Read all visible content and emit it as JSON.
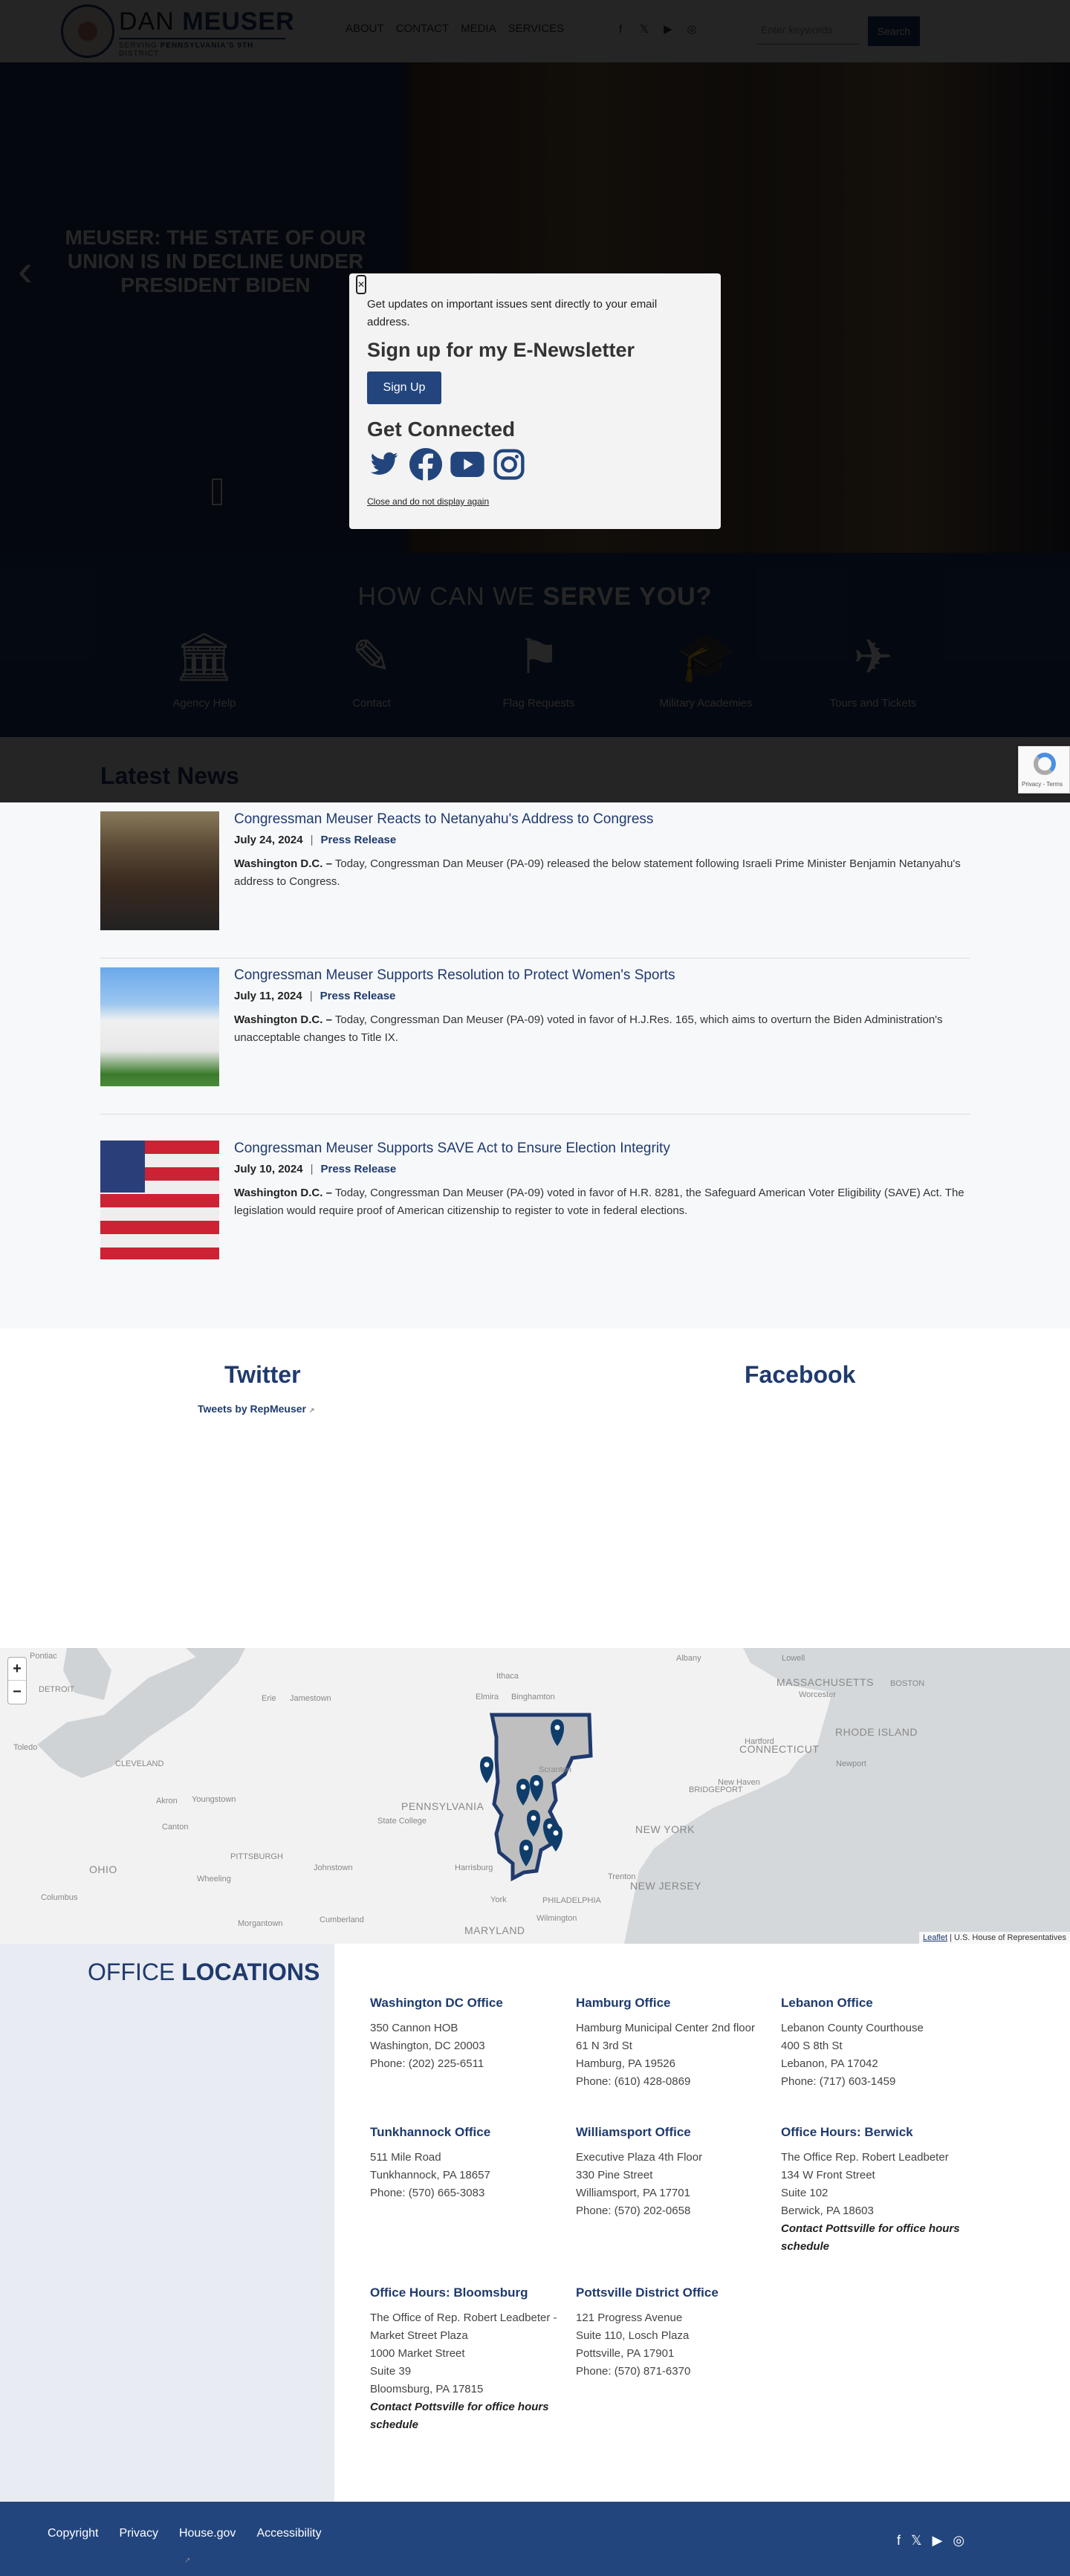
{
  "header": {
    "brand_first": "DAN",
    "brand_last": "MEUSER",
    "brand_sub_prefix": "SERVING",
    "brand_sub_bold": "PENNSYLVANIA'S 9TH",
    "brand_sub_suffix": "DISTRICT",
    "nav": [
      "ABOUT",
      "CONTACT",
      "MEDIA",
      "SERVICES"
    ],
    "social_icons": [
      "facebook-icon",
      "x-icon",
      "youtube-icon",
      "instagram-icon"
    ],
    "search_placeholder": "Enter keywords",
    "search_button": "Search"
  },
  "hero": {
    "title": "MEUSER: THE STATE OF OUR UNION IS IN DECLINE UNDER PRESIDENT BIDEN",
    "prev_icon": "chevron-left-icon"
  },
  "serve": {
    "title_light": "HOW CAN WE",
    "title_bold": "SERVE YOU?",
    "items": [
      {
        "label": "Agency Help",
        "icon": "building-columns-icon"
      },
      {
        "label": "Contact",
        "icon": "pencil-icon"
      },
      {
        "label": "Flag Requests",
        "icon": "flag-icon"
      },
      {
        "label": "Military Academies",
        "icon": "graduation-cap-icon"
      },
      {
        "label": "Tours and Tickets",
        "icon": "airplane-icon"
      }
    ]
  },
  "news": {
    "title": "Latest News",
    "articles": [
      {
        "title": "Congressman Meuser Reacts to Netanyahu's Address to Congress",
        "date": "July 24, 2024",
        "category": "Press Release",
        "dateline": "Washington D.C. –",
        "text": " Today, Congressman Dan Meuser (PA-09) released the below statement following Israeli Prime Minister Benjamin Netanyahu's address to Congress."
      },
      {
        "title": "Congressman Meuser Supports Resolution to Protect Women's Sports",
        "date": "July 11, 2024",
        "category": "Press Release",
        "dateline": "Washington D.C. –",
        "text": " Today, Congressman Dan Meuser (PA-09) voted in favor of H.J.Res. 165, which aims to overturn the Biden Administration's unacceptable changes to Title IX."
      },
      {
        "title": "Congressman Meuser Supports SAVE Act to Ensure Election Integrity",
        "date": "July 10, 2024",
        "category": "Press Release",
        "dateline": "Washington D.C. –",
        "text": " Today, Congressman Dan Meuser (PA-09) voted in favor of H.R. 8281, the Safeguard American Voter Eligibility (SAVE) Act. The legislation would require proof of American citizenship to register to vote in federal elections."
      }
    ],
    "separator": "|"
  },
  "social": {
    "twitter_title": "Twitter",
    "twitter_link": "Tweets by RepMeuser",
    "facebook_title": "Facebook"
  },
  "map": {
    "zoom_in": "+",
    "zoom_out": "−",
    "attribution_link": "Leaflet",
    "attribution_text": " | U.S. House of Representatives",
    "labels": [
      {
        "text": "Pontiac",
        "kind": "small"
      },
      {
        "text": "DETROIT",
        "kind": "small"
      },
      {
        "text": "Toledo",
        "kind": "small"
      },
      {
        "text": "CLEVELAND",
        "kind": "small"
      },
      {
        "text": "Erie",
        "kind": "small"
      },
      {
        "text": "Jamestown",
        "kind": "small"
      },
      {
        "text": "Akron",
        "kind": "small"
      },
      {
        "text": "Youngstown",
        "kind": "small"
      },
      {
        "text": "Canton",
        "kind": "small"
      },
      {
        "text": "PITTSBURGH",
        "kind": "small"
      },
      {
        "text": "Johnstown",
        "kind": "small"
      },
      {
        "text": "OHIO",
        "kind": "big"
      },
      {
        "text": "Columbus",
        "kind": "small"
      },
      {
        "text": "Wheeling",
        "kind": "small"
      },
      {
        "text": "Morgantown",
        "kind": "small"
      },
      {
        "text": "Cumberland",
        "kind": "small"
      },
      {
        "text": "PENNSYLVANIA",
        "kind": "big"
      },
      {
        "text": "State College",
        "kind": "small"
      },
      {
        "text": "Harrisburg",
        "kind": "small"
      },
      {
        "text": "York",
        "kind": "small"
      },
      {
        "text": "MARYLAND",
        "kind": "big"
      },
      {
        "text": "Ithaca",
        "kind": "small"
      },
      {
        "text": "Elmira",
        "kind": "small"
      },
      {
        "text": "Binghamton",
        "kind": "small"
      },
      {
        "text": "Albany",
        "kind": "small"
      },
      {
        "text": "Lowell",
        "kind": "small"
      },
      {
        "text": "MASSACHUSETTS",
        "kind": "big"
      },
      {
        "text": "BOSTON",
        "kind": "small"
      },
      {
        "text": "Worcester",
        "kind": "small"
      },
      {
        "text": "Hartford",
        "kind": "small"
      },
      {
        "text": "CONNECTICUT",
        "kind": "big"
      },
      {
        "text": "RHODE ISLAND",
        "kind": "big"
      },
      {
        "text": "Newport",
        "kind": "small"
      },
      {
        "text": "New Haven",
        "kind": "small"
      },
      {
        "text": "BRIDGEPORT",
        "kind": "small"
      },
      {
        "text": "NEW YORK",
        "kind": "big"
      },
      {
        "text": "Trenton",
        "kind": "small"
      },
      {
        "text": "NEW JERSEY",
        "kind": "big"
      },
      {
        "text": "PHILADELPHIA",
        "kind": "small"
      },
      {
        "text": "Wilmington",
        "kind": "small"
      },
      {
        "text": "Scranton",
        "kind": "small"
      }
    ],
    "district_color": "#1f3a6e",
    "marker_count": 8
  },
  "offices": {
    "title_light": "OFFICE",
    "title_bold": "LOCATIONS",
    "list": [
      {
        "name": "Washington DC Office",
        "lines": [
          "350 Cannon HOB",
          "Washington, DC 20003",
          "Phone: (202) 225-6511"
        ],
        "note": ""
      },
      {
        "name": "Hamburg Office",
        "lines": [
          "Hamburg Municipal Center 2nd floor",
          "61 N 3rd St",
          "Hamburg, PA 19526",
          "Phone: (610) 428-0869"
        ],
        "note": ""
      },
      {
        "name": "Lebanon Office",
        "lines": [
          "Lebanon County Courthouse",
          "400 S 8th St",
          "Lebanon, PA 17042",
          "Phone: (717) 603-1459"
        ],
        "note": ""
      },
      {
        "name": "Tunkhannock Office",
        "lines": [
          "511 Mile Road",
          "Tunkhannock, PA 18657",
          "Phone: (570) 665-3083"
        ],
        "note": ""
      },
      {
        "name": "Williamsport Office",
        "lines": [
          "Executive Plaza 4th Floor",
          "330 Pine Street",
          "Williamsport, PA 17701",
          "Phone: (570) 202-0658"
        ],
        "note": ""
      },
      {
        "name": "Office Hours: Berwick",
        "lines": [
          "The Office Rep. Robert Leadbeter",
          "134 W Front Street",
          "Suite 102",
          "Berwick, PA 18603"
        ],
        "note": "Contact Pottsville for office hours schedule"
      },
      {
        "name": "Office Hours: Bloomsburg",
        "lines": [
          "The Office of Rep. Robert Leadbeter - Market Street Plaza",
          "1000 Market Street",
          "Suite 39",
          "Bloomsburg, PA 17815"
        ],
        "note": "Contact Pottsville for office hours schedule"
      },
      {
        "name": "Pottsville District Office",
        "lines": [
          "121 Progress Avenue",
          "Suite 110, Losch Plaza",
          "Pottsville, PA 17901",
          "Phone: (570) 871-6370"
        ],
        "note": ""
      }
    ]
  },
  "footer": {
    "links": [
      "Copyright",
      "Privacy",
      "House.gov",
      "Accessibility"
    ],
    "social_icons": [
      "facebook-icon",
      "x-icon",
      "youtube-icon",
      "instagram-icon"
    ]
  },
  "modal": {
    "close_icon": "close-icon",
    "intro": "Get updates on important issues sent directly to your email address.",
    "heading": "Sign up for my E-Newsletter",
    "button": "Sign Up",
    "connected": "Get Connected",
    "social_icons": [
      "twitter-icon",
      "facebook-icon",
      "youtube-icon",
      "instagram-icon"
    ],
    "dismiss": "Close and do not display again"
  },
  "recaptcha": {
    "label": "Privacy - Terms"
  }
}
